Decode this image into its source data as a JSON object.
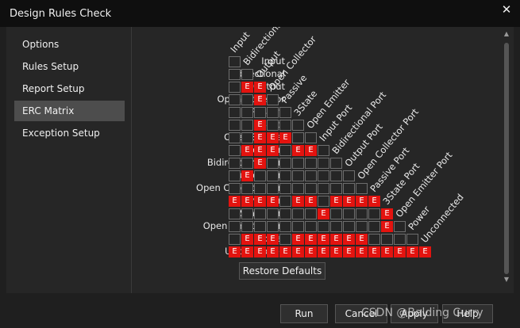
{
  "window": {
    "title": "Design Rules Check",
    "close_glyph": "✕"
  },
  "sidebar": {
    "items": [
      {
        "label": "Options",
        "active": false
      },
      {
        "label": "Rules Setup",
        "active": false
      },
      {
        "label": "Report Setup",
        "active": false
      },
      {
        "label": "ERC Matrix",
        "active": true
      },
      {
        "label": "Exception Setup",
        "active": false
      }
    ]
  },
  "matrix": {
    "types": [
      "Input",
      "Bidirectional",
      "Output",
      "Open Collector",
      "Passive",
      "3State",
      "Open Emitter",
      "Input Port",
      "Bidirectional Port",
      "Output Port",
      "Open Collector Port",
      "Passive Port",
      "3State Port",
      "Open Emitter Port",
      "Power",
      "Unconnected"
    ],
    "error_symbol": "E",
    "error_color": "#e3130f",
    "errors": [
      [],
      [],
      [
        1,
        2
      ],
      [
        2
      ],
      [],
      [
        2
      ],
      [
        2,
        3,
        4
      ],
      [
        1,
        2,
        3,
        5,
        6,
        8
      ],
      [
        2
      ],
      [
        1
      ],
      [],
      [
        0,
        1,
        2,
        3,
        5,
        6,
        8,
        9,
        10,
        11,
        12
      ],
      [
        7,
        12
      ],
      [
        12
      ],
      [
        1,
        2,
        3,
        5,
        6,
        7,
        8,
        9,
        10
      ],
      [
        0,
        1,
        2,
        3,
        4,
        5,
        6,
        7,
        8,
        9,
        10,
        11,
        12,
        13,
        14,
        15
      ]
    ]
  },
  "actions": {
    "restore_defaults": "Restore Defaults",
    "run": "Run",
    "cancel": "Cancel",
    "apply": "Apply",
    "help": "Help"
  },
  "watermark": "CSDN @Balding Curry"
}
